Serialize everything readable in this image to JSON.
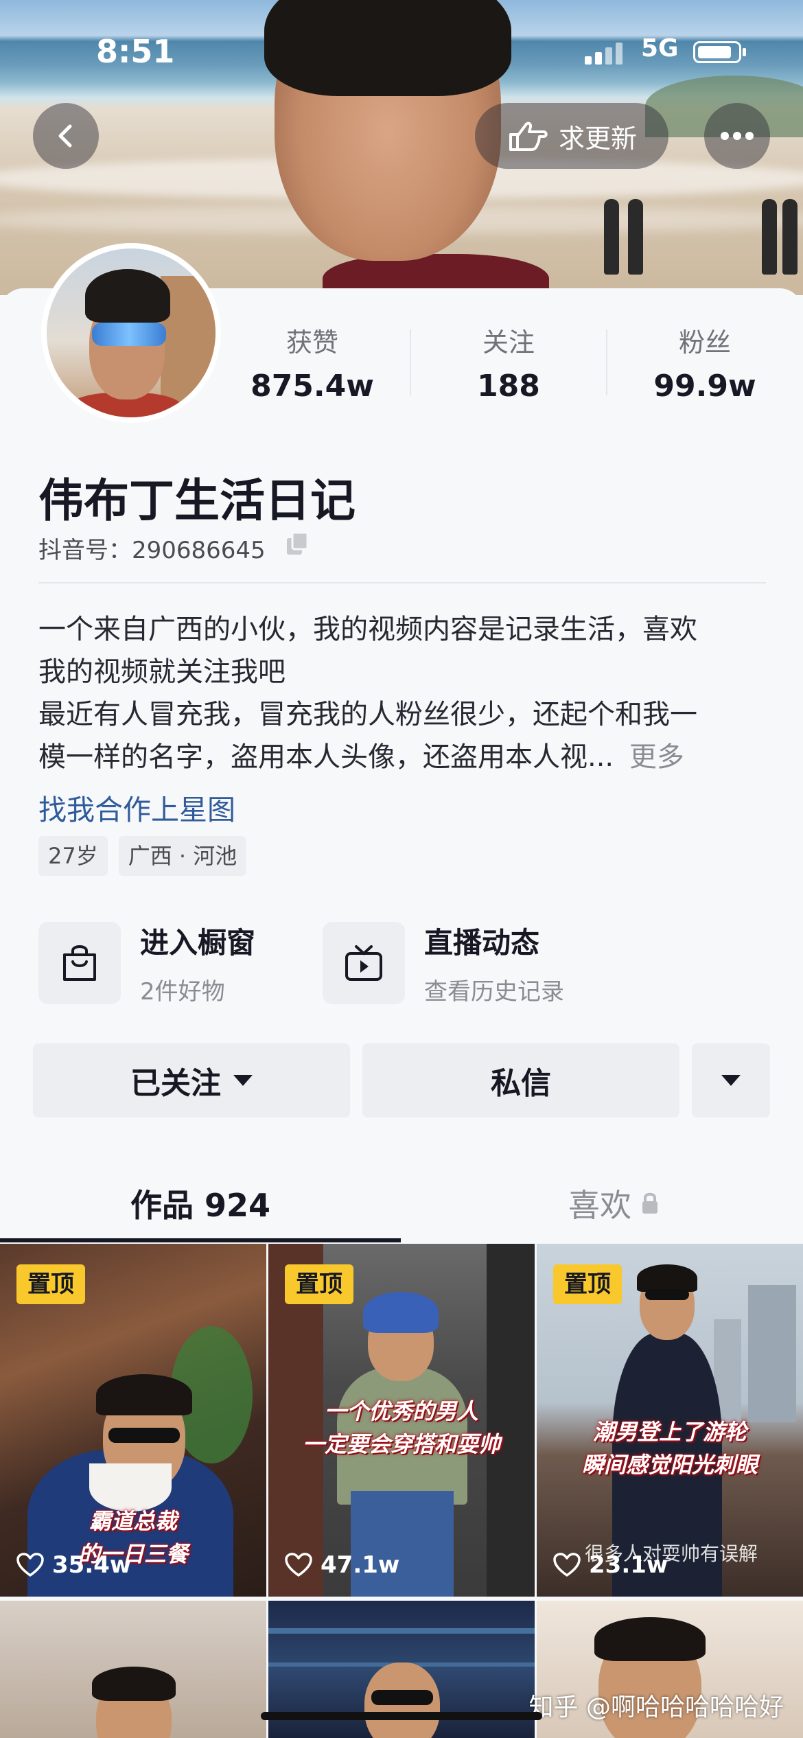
{
  "status_bar": {
    "time": "8:51",
    "network": "5G"
  },
  "header": {
    "update_label": "求更新"
  },
  "stats": [
    {
      "label": "获赞",
      "value": "875.4w"
    },
    {
      "label": "关注",
      "value": "188"
    },
    {
      "label": "粉丝",
      "value": "99.9w"
    }
  ],
  "profile": {
    "nickname": "伟布丁生活日记",
    "douyin_id": "抖音号：290686645",
    "bio_line1": "一个来自广西的小伙，我的视频内容是记录生活，喜欢",
    "bio_line2": "我的视频就关注我吧",
    "bio_line3": "最近有人冒充我，冒充我的人粉丝很少，还起个和我一",
    "bio_line4": "模一样的名字，盗用本人头像，还盗用本人视...",
    "bio_more": "更多",
    "cooperate_link": "找我合作上星图",
    "tags": [
      "27岁",
      "广西 · 河池"
    ]
  },
  "entries": [
    {
      "title": "进入橱窗",
      "sub": "2件好物"
    },
    {
      "title": "直播动态",
      "sub": "查看历史记录"
    }
  ],
  "actions": {
    "follow_label": "已关注",
    "message_label": "私信"
  },
  "tabs": {
    "works": "作品 924",
    "likes": "喜欢"
  },
  "videos": [
    {
      "pin": "置顶",
      "likes": "35.4w",
      "caption_line1": "霸道总裁",
      "caption_line2": "的一日三餐"
    },
    {
      "pin": "置顶",
      "likes": "47.1w",
      "caption_line1": "一个优秀的男人",
      "caption_line2": "一定要会穿搭和耍帅"
    },
    {
      "pin": "置顶",
      "likes": "23.1w",
      "caption_line1": "潮男登上了游轮",
      "caption_line2": "瞬间感觉阳光刺眼",
      "caption_extra": "很多人对耍帅有误解"
    }
  ],
  "watermark": "知乎 @啊哈哈哈哈哈好"
}
